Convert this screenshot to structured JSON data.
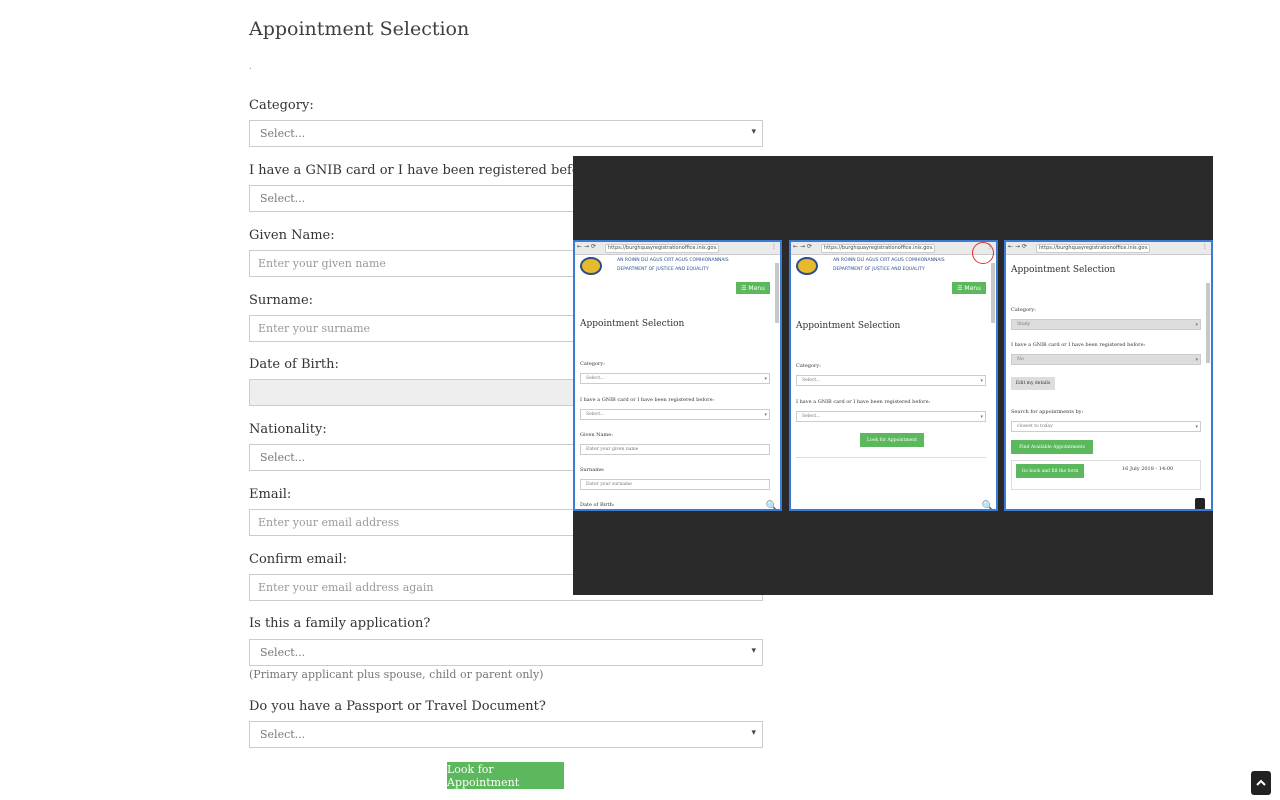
{
  "page": {
    "title": "Appointment Selection",
    "dot": "."
  },
  "form": {
    "category": {
      "label": "Category:",
      "value": "Select..."
    },
    "gnib": {
      "label": "I have a GNIB card or I have been registered before:",
      "value": "Select..."
    },
    "given_name": {
      "label": "Given Name:",
      "placeholder": "Enter your given name"
    },
    "surname": {
      "label": "Surname:",
      "placeholder": "Enter your surname"
    },
    "dob": {
      "label": "Date of Birth:",
      "value": ""
    },
    "nationality": {
      "label": "Nationality:",
      "value": "Select..."
    },
    "email": {
      "label": "Email:",
      "placeholder": "Enter your email address"
    },
    "confirm_email": {
      "label": "Confirm email:",
      "placeholder": "Enter your email address again"
    },
    "family": {
      "label": "Is this a family application?",
      "value": "Select...",
      "help": "(Primary applicant plus spouse, child or parent only)"
    },
    "passport": {
      "label": "Do you have a Passport or Travel Document?",
      "value": "Select..."
    },
    "submit_label": "Look for Appointment"
  },
  "scroll_top_icon": "chevron-up-icon",
  "overlay": {
    "url": "https://burghquayregistrationoffice.inis.gov...",
    "dept_line1": "AN ROINN DLÍ AGUS CIRT AGUS COMHIONANNAIS",
    "dept_line2": "DEPARTMENT OF JUSTICE AND EQUALITY",
    "menu_label": "☰ Menu",
    "phone1": {
      "title": "Appointment Selection",
      "category_label": "Category:",
      "category_value": "Select...",
      "gnib_label": "I have a GNIB card or I have been registered before:",
      "gnib_value": "Select...",
      "given_label": "Given Name:",
      "given_placeholder": "Enter your given name",
      "surname_label": "Surname:",
      "surname_placeholder": "Enter your surname",
      "dob_label": "Date of Birth:"
    },
    "phone2": {
      "title": "Appointment Selection",
      "category_label": "Category:",
      "category_value": "Select...",
      "gnib_label": "I have a GNIB card or I have been registered before:",
      "gnib_value": "Select...",
      "button": "Look for Appointment"
    },
    "phone3": {
      "title": "Appointment Selection",
      "category_label": "Category:",
      "category_value": "Study",
      "gnib_label": "I have a GNIB card or I have been registered before:",
      "gnib_value": "No",
      "edit_button": "Edit my details",
      "search_label": "Search for appointments by:",
      "search_value": "closest to today",
      "find_button": "Find Available Appointments",
      "back_button": "Go back and fill the form",
      "slot": "16 July 2018 - 14:00"
    }
  }
}
